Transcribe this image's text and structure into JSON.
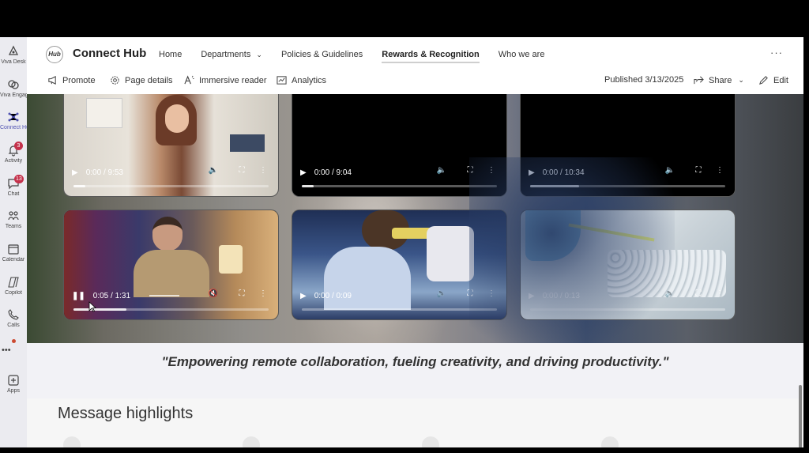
{
  "rail": [
    {
      "label": "Viva Desk",
      "icon": "viva-desk-icon"
    },
    {
      "label": "Viva Engage",
      "icon": "viva-engage-icon"
    },
    {
      "label": "Connect Hub",
      "icon": "connect-hub-icon",
      "active": true
    },
    {
      "label": "Activity",
      "icon": "bell-icon",
      "badge": "3"
    },
    {
      "label": "Chat",
      "icon": "chat-icon",
      "badge": "13"
    },
    {
      "label": "Teams",
      "icon": "teams-icon"
    },
    {
      "label": "Calendar",
      "icon": "calendar-icon"
    },
    {
      "label": "Copilot",
      "icon": "copilot-icon"
    },
    {
      "label": "Calls",
      "icon": "phone-icon"
    },
    {
      "label": "•••",
      "icon": "more-icon"
    },
    {
      "label": "Apps",
      "icon": "add-apps-icon"
    }
  ],
  "header": {
    "logo_text": "Hub",
    "site_title": "Connect Hub",
    "nav": [
      "Home",
      "Departments",
      "Policies & Guidelines",
      "Rewards & Recognition",
      "Who we are"
    ],
    "more": "···"
  },
  "commands": {
    "promote": "Promote",
    "page_details": "Page details",
    "immersive_reader": "Immersive reader",
    "analytics": "Analytics",
    "published": "Published 3/13/2025",
    "share": "Share",
    "edit": "Edit"
  },
  "videos": [
    {
      "time": "0:00 / 9:53",
      "progress": 0.06,
      "state": "paused",
      "thumb": "presenter-shelf"
    },
    {
      "time": "0:00 / 9:04",
      "progress": 0.06,
      "state": "paused",
      "thumb": "black"
    },
    {
      "time": "0:00 / 10:34",
      "progress": 0.25,
      "state": "paused",
      "thumb": "black"
    },
    {
      "time": "0:05 / 1:31",
      "progress": 0.27,
      "state": "playing",
      "thumb": "presenter-studio",
      "muted": true
    },
    {
      "time": "0:00 / 0:09",
      "progress": 0,
      "state": "paused",
      "thumb": "lab-microscope"
    },
    {
      "time": "0:00 / 0:13",
      "progress": 0,
      "state": "paused",
      "thumb": "lab-pipette"
    }
  ],
  "quote": "\"Empowering remote collaboration, fueling creativity, and driving productivity.\"",
  "highlights": {
    "title": "Message highlights"
  },
  "colors": {
    "accent": "#4f52b2",
    "badge": "#c4314b"
  }
}
